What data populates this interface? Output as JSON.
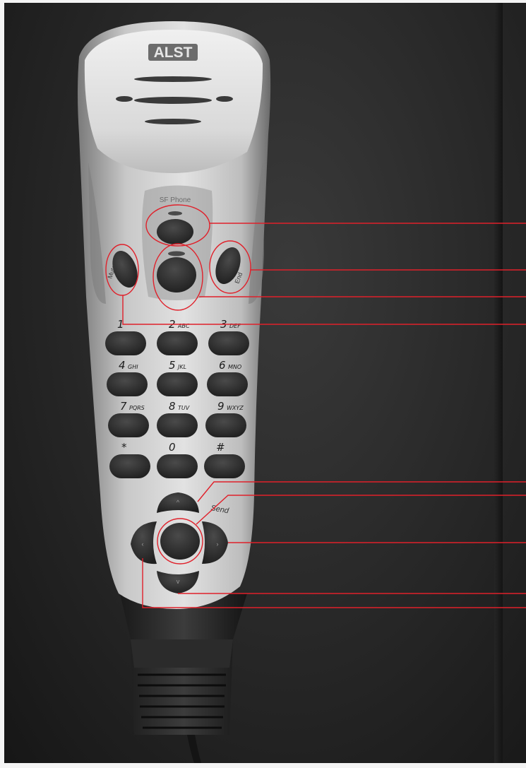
{
  "device": {
    "brand": "ALST",
    "top_button_label": "SF Phone",
    "mute_label": "Mute",
    "end_label": "End",
    "send_label": "Send"
  },
  "keypad": {
    "keys": [
      {
        "main": "1",
        "sub": ""
      },
      {
        "main": "2",
        "sub": "ABC"
      },
      {
        "main": "3",
        "sub": "DEF"
      },
      {
        "main": "4",
        "sub": "GHI"
      },
      {
        "main": "5",
        "sub": "JKL"
      },
      {
        "main": "6",
        "sub": "MNO"
      },
      {
        "main": "7",
        "sub": "PQRS"
      },
      {
        "main": "8",
        "sub": "TUV"
      },
      {
        "main": "9",
        "sub": "WXYZ"
      },
      {
        "main": "*",
        "sub": ""
      },
      {
        "main": "0",
        "sub": ""
      },
      {
        "main": "#",
        "sub": ""
      }
    ]
  },
  "colors": {
    "callout": "#e0202a",
    "body": "#c9c9c9",
    "button": "#2e2e2e"
  }
}
